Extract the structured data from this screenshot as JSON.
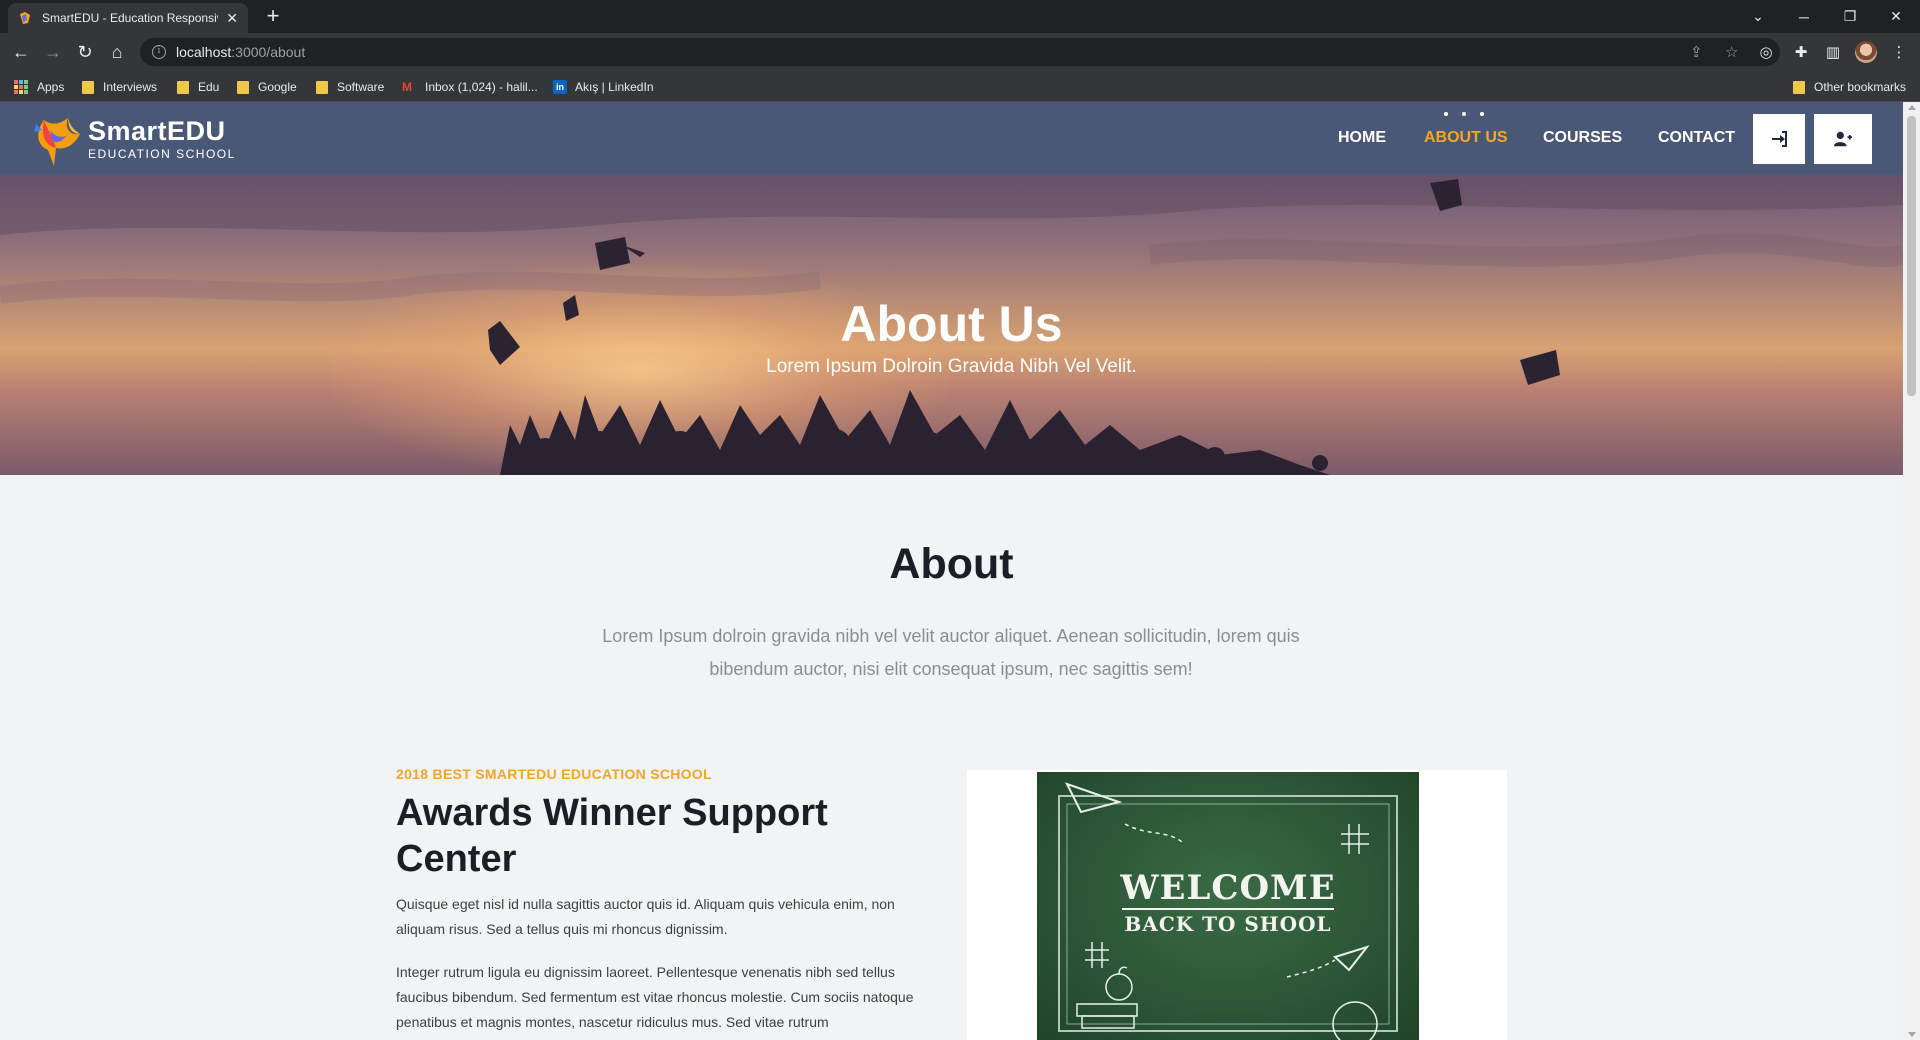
{
  "browser": {
    "tab_title": "SmartEDU - Education Responsiv",
    "url_host": "localhost",
    "url_path": ":3000/about",
    "bookmarks": [
      "Apps",
      "Interviews",
      "Edu",
      "Google",
      "Software",
      "Inbox (1,024) - halil...",
      "Akış | LinkedIn"
    ],
    "other_bookmarks": "Other bookmarks"
  },
  "header": {
    "brand": "SmartEDU",
    "tagline": "EDUCATION SCHOOL",
    "nav": [
      "HOME",
      "ABOUT US",
      "COURSES",
      "CONTACT"
    ],
    "active_nav": "ABOUT US",
    "accent_color": "#f5a623",
    "header_color": "#4a5878"
  },
  "hero": {
    "title": "About Us",
    "subtitle": "Lorem Ipsum Dolroin Gravida Nibh Vel Velit."
  },
  "about": {
    "title": "About",
    "lead": "Lorem Ipsum dolroin gravida nibh vel velit auctor aliquet. Aenean sollicitudin, lorem quis bibendum auctor, nisi elit consequat ipsum, nec sagittis sem!"
  },
  "award": {
    "kicker": "2018 BEST SMARTEDU EDUCATION SCHOOL",
    "title": "Awards Winner Support Center",
    "p1": "Quisque eget nisl id nulla sagittis auctor quis id. Aliquam quis vehicula enim, non aliquam risus. Sed a tellus quis mi rhoncus dignissim.",
    "p2": "Integer rutrum ligula eu dignissim laoreet. Pellentesque venenatis nibh sed tellus faucibus bibendum. Sed fermentum est vitae rhoncus molestie. Cum sociis natoque penatibus et magnis montes, nascetur ridiculus mus. Sed vitae rutrum",
    "image_line1": "WELCOME",
    "image_line2": "BACK TO SHOOL"
  }
}
